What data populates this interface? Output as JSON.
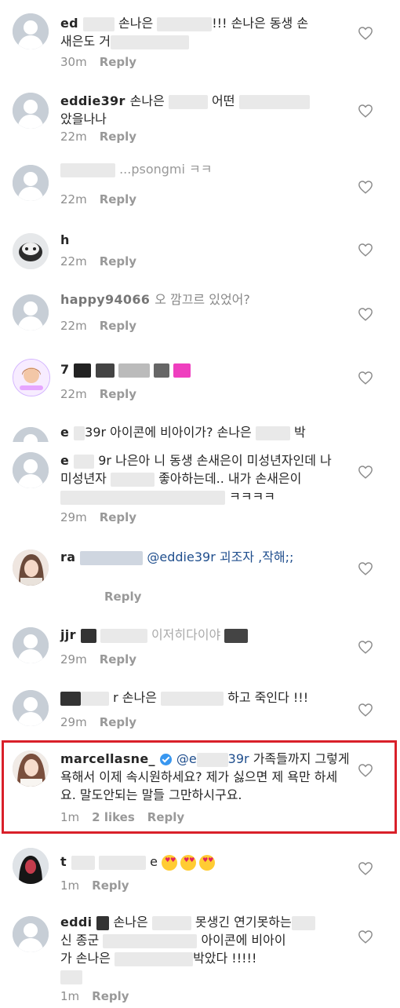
{
  "comments": [
    {
      "user": "ed",
      "text": "손나은",
      "text2": "!!! 손나은 동생 손",
      "text3": "새은도 거",
      "time": "30m",
      "reply": "Reply"
    },
    {
      "user": "eddie39r",
      "text": "손나은",
      "text2": "어떤",
      "text3": "았을나나",
      "time": "22m",
      "reply": "Reply"
    },
    {
      "user": "",
      "text": "...psongmi ㅋㅋ",
      "time": "22m",
      "reply": "Reply"
    },
    {
      "user": "h",
      "text": "",
      "time": "22m",
      "reply": "Reply"
    },
    {
      "user": "happy94066",
      "text": "오 깜끄르 있었어?",
      "time": "22m",
      "reply": "Reply"
    },
    {
      "user": "7",
      "text": "",
      "time": "22m",
      "reply": "Reply"
    },
    {
      "user": "e",
      "text": "39r 아이콘에 비아이가? 손나은",
      "text2": "박",
      "time": "",
      "reply": ""
    },
    {
      "user": "e",
      "text": "9r 나은아 니 동생 손새은이 미성년자인데 나 미성년자",
      "text2": "좋아하는데.. 내가 손새은이",
      "text3": "ㅋㅋㅋㅋ",
      "time": "29m",
      "reply": "Reply"
    },
    {
      "user": "ra",
      "text": "@eddie39r 괴조자 ,작해;;",
      "time": "Reply",
      "reply": "Reply"
    },
    {
      "user": "jjr",
      "text": "이저히다이야",
      "time": "29m",
      "reply": "Reply"
    },
    {
      "user": "",
      "text": "r 손나은",
      "text2": "하고 죽인다 !!!",
      "time": "29m",
      "reply": "Reply"
    },
    {
      "user": "marcellasne_",
      "mention": "@e",
      "mention2": "39r",
      "text": "가족들까지 그렇게 욕해서 이제 속시원하세요? 제가 싫으면 제 욕만 하세요. 말도안되는 말들 그만하시구요.",
      "time": "1m",
      "likes": "2 likes",
      "reply": "Reply"
    },
    {
      "user": "t",
      "text": "e",
      "time": "1m",
      "reply": "Reply"
    },
    {
      "user": "eddi",
      "text": "손나은",
      "text2": "못생긴 연기못하는",
      "text3": "신 종군",
      "text4": "아이콘에 비아이",
      "text5": "가 손나은",
      "text6": "박았다 !!!!!",
      "time": "1m",
      "reply": "Reply"
    }
  ],
  "icons": {
    "heart": "heart-outline-icon",
    "avatar": "default-avatar-icon",
    "verified": "verified-badge-icon"
  },
  "colors": {
    "highlight": "#d9202a",
    "verified": "#3897f0",
    "meta": "#8e8e8e"
  }
}
